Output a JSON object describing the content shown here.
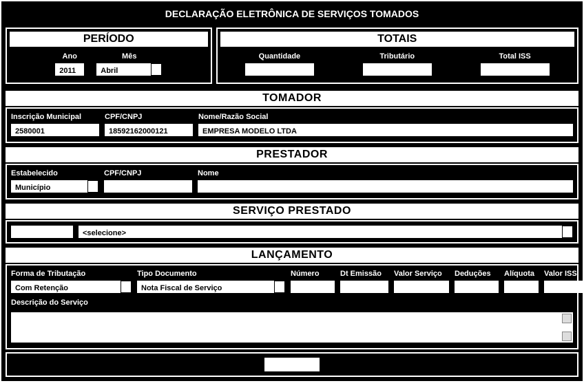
{
  "title": "DECLARAÇÃO ELETRÔNICA DE SERVIÇOS TOMADOS",
  "periodo": {
    "header": "PERÍODO",
    "ano_label": "Ano",
    "ano_value": "2011",
    "mes_label": "Mês",
    "mes_value": "Abril"
  },
  "totais": {
    "header": "TOTAIS",
    "quantidade_label": "Quantidade",
    "quantidade_value": "",
    "tributario_label": "Tributário",
    "tributario_value": "",
    "total_iss_label": "Total ISS",
    "total_iss_value": ""
  },
  "tomador": {
    "header": "TOMADOR",
    "inscricao_label": "Inscrição Municipal",
    "inscricao_value": "2580001",
    "cpfcnpj_label": "CPF/CNPJ",
    "cpfcnpj_value": "18592162000121",
    "nome_label": "Nome/Razão Social",
    "nome_value": "EMPRESA MODELO LTDA"
  },
  "prestador": {
    "header": "PRESTADOR",
    "estab_label": "Estabelecido",
    "estab_value": "Município",
    "cpfcnpj_label": "CPF/CNPJ",
    "cpfcnpj_value": "",
    "nome_label": "Nome",
    "nome_value": ""
  },
  "servico": {
    "header": "SERVIÇO PRESTADO",
    "code_value": "",
    "select_value": "<selecione>"
  },
  "lancamento": {
    "header": "LANÇAMENTO",
    "forma_label": "Forma de Tributação",
    "forma_value": "Com Retenção",
    "tipo_label": "Tipo Documento",
    "tipo_value": "Nota Fiscal de Serviço",
    "numero_label": "Número",
    "numero_value": "",
    "dtemissao_label": "Dt Emissão",
    "dtemissao_value": "",
    "valorserv_label": "Valor Serviço",
    "valorserv_value": "",
    "deducoes_label": "Deduções",
    "deducoes_value": "",
    "aliquota_label": "Alíquota",
    "aliquota_value": "",
    "valoriss_label": "Valor ISS",
    "valoriss_value": "",
    "descricao_label": "Descrição do Serviço",
    "descricao_value": ""
  }
}
